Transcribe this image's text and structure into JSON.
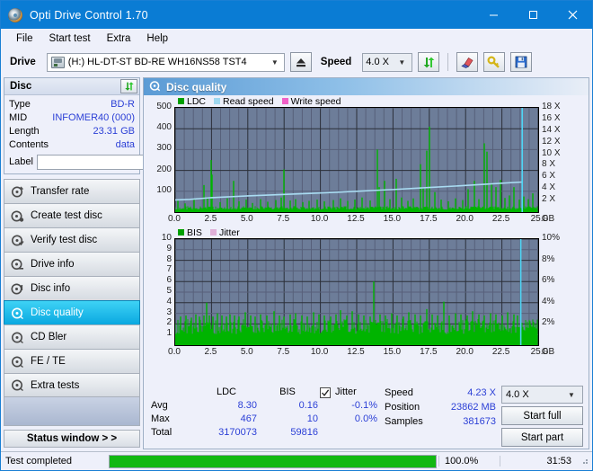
{
  "window": {
    "title": "Opti Drive Control 1.70",
    "icon": "disc-icon",
    "minimize_label": "–",
    "maximize_label": "☐",
    "close_label": "✕"
  },
  "menu": {
    "items": [
      "File",
      "Start test",
      "Extra",
      "Help"
    ]
  },
  "toolbar": {
    "drive_label": "Drive",
    "drive_value": "(H:)  HL-DT-ST BD-RE  WH16NS58 TST4",
    "eject_icon": "eject-icon",
    "speed_label": "Speed",
    "speed_value": "4.0 X",
    "refresh_icon": "refresh-icon",
    "eraser_icon": "eraser-icon",
    "tools_icon": "key-icon",
    "save_icon": "save-icon"
  },
  "disc_panel": {
    "title": "Disc",
    "refresh_icon": "refresh-icon",
    "rows": [
      {
        "key": "Type",
        "value": "BD-R"
      },
      {
        "key": "MID",
        "value": "INFOMER40 (000)"
      },
      {
        "key": "Length",
        "value": "23.31 GB"
      },
      {
        "key": "Contents",
        "value": "data"
      }
    ],
    "label_key": "Label",
    "label_value": "",
    "label_placeholder": "",
    "disc_icon": "disc-icon"
  },
  "sidebar": {
    "items": [
      {
        "label": "Transfer rate",
        "icon": "disc-rate-icon",
        "active": false
      },
      {
        "label": "Create test disc",
        "icon": "disc-write-icon",
        "active": false
      },
      {
        "label": "Verify test disc",
        "icon": "disc-verify-icon",
        "active": false
      },
      {
        "label": "Drive info",
        "icon": "drive-info-icon",
        "active": false
      },
      {
        "label": "Disc info",
        "icon": "disc-info-icon",
        "active": false
      },
      {
        "label": "Disc quality",
        "icon": "disc-quality-icon",
        "active": true
      },
      {
        "label": "CD Bler",
        "icon": "disc-bler-icon",
        "active": false
      },
      {
        "label": "FE / TE",
        "icon": "disc-fete-icon",
        "active": false
      },
      {
        "label": "Extra tests",
        "icon": "disc-extra-icon",
        "active": false
      }
    ],
    "status_window_label": "Status window > >"
  },
  "main": {
    "title": "Disc quality",
    "icon": "disc-quality-icon"
  },
  "chart_data": [
    {
      "id": "ldc-chart",
      "type": "bar",
      "title": "Disc quality",
      "xlabel": "",
      "ylabel": "",
      "xunit": "GB",
      "grid": true,
      "legend_position": "top-left",
      "legend": [
        {
          "label": "LDC",
          "color": "#00a000"
        },
        {
          "label": "Read speed",
          "color": "#9fd8f0"
        },
        {
          "label": "Write speed",
          "color": "#f060c8"
        }
      ],
      "xlim": [
        0,
        25
      ],
      "xticks": [
        "0.0",
        "2.5",
        "5.0",
        "7.5",
        "10.0",
        "12.5",
        "15.0",
        "17.5",
        "20.0",
        "22.5",
        "25.0"
      ],
      "ylim": [
        0,
        500
      ],
      "yticks": [
        "100",
        "200",
        "300",
        "400",
        "500"
      ],
      "y2lim": [
        0,
        18
      ],
      "y2ticks": [
        "2 X",
        "4 X",
        "6 X",
        "8 X",
        "10 X",
        "12 X",
        "14 X",
        "16 X",
        "18 X"
      ],
      "series": [
        {
          "name": "LDC",
          "color": "#00b400",
          "baseline": 22,
          "spikes": [
            [
              0.2,
              55
            ],
            [
              0.7,
              42
            ],
            [
              1.3,
              60
            ],
            [
              2.0,
              130
            ],
            [
              2.25,
              72
            ],
            [
              2.5,
              250
            ],
            [
              2.55,
              180
            ],
            [
              3.1,
              48
            ],
            [
              3.6,
              66
            ],
            [
              4.0,
              150
            ],
            [
              4.4,
              52
            ],
            [
              4.9,
              60
            ],
            [
              5.3,
              44
            ],
            [
              5.9,
              62
            ],
            [
              6.4,
              50
            ],
            [
              6.9,
              58
            ],
            [
              7.3,
              70
            ],
            [
              7.5,
              205
            ],
            [
              7.9,
              56
            ],
            [
              8.3,
              62
            ],
            [
              8.8,
              48
            ],
            [
              9.2,
              54
            ],
            [
              9.8,
              60
            ],
            [
              10.3,
              52
            ],
            [
              10.9,
              58
            ],
            [
              11.4,
              66
            ],
            [
              11.9,
              54
            ],
            [
              12.4,
              60
            ],
            [
              12.9,
              70
            ],
            [
              13.4,
              56
            ],
            [
              13.9,
              300
            ],
            [
              14.05,
              120
            ],
            [
              14.4,
              150
            ],
            [
              14.8,
              62
            ],
            [
              15.2,
              160
            ],
            [
              15.6,
              70
            ],
            [
              16.0,
              54
            ],
            [
              16.4,
              66
            ],
            [
              16.9,
              230
            ],
            [
              17.1,
              120
            ],
            [
              17.35,
              295
            ],
            [
              17.5,
              410
            ],
            [
              17.9,
              96
            ],
            [
              18.3,
              60
            ],
            [
              18.8,
              52
            ],
            [
              19.3,
              66
            ],
            [
              19.8,
              58
            ],
            [
              20.2,
              110
            ],
            [
              20.6,
              150
            ],
            [
              20.9,
              62
            ],
            [
              21.3,
              330
            ],
            [
              21.5,
              290
            ],
            [
              21.8,
              140
            ],
            [
              22.1,
              120
            ],
            [
              22.4,
              155
            ],
            [
              22.7,
              68
            ],
            [
              23.0,
              80
            ],
            [
              23.3,
              120
            ],
            [
              23.7,
              60
            ],
            [
              24.0,
              75
            ],
            [
              24.3,
              62
            ],
            [
              24.6,
              90
            ]
          ]
        },
        {
          "name": "Read speed",
          "color": "#a9dcf2",
          "points": [
            [
              0.0,
              2.1
            ],
            [
              1.0,
              2.2
            ],
            [
              2.5,
              2.5
            ],
            [
              5.0,
              2.8
            ],
            [
              7.5,
              3.05
            ],
            [
              10.0,
              3.3
            ],
            [
              12.5,
              3.6
            ],
            [
              15.0,
              3.9
            ],
            [
              17.5,
              4.25
            ],
            [
              20.0,
              4.6
            ],
            [
              22.5,
              5.0
            ],
            [
              23.9,
              5.2
            ]
          ]
        },
        {
          "name": "Write speed",
          "color": "#f060c8",
          "points": []
        }
      ],
      "end_marker": {
        "x": 23.9,
        "color": "#4fd5f5"
      }
    },
    {
      "id": "bis-chart",
      "type": "bar",
      "title": "",
      "xunit": "GB",
      "grid": true,
      "legend_position": "top-left",
      "legend": [
        {
          "label": "BIS",
          "color": "#00a000"
        },
        {
          "label": "Jitter",
          "color": "#e0b0d8"
        }
      ],
      "xlim": [
        0,
        25
      ],
      "xticks": [
        "0.0",
        "2.5",
        "5.0",
        "7.5",
        "10.0",
        "12.5",
        "15.0",
        "17.5",
        "20.0",
        "22.5",
        "25.0"
      ],
      "ylim": [
        0,
        10
      ],
      "yticks": [
        "1",
        "2",
        "3",
        "4",
        "5",
        "6",
        "7",
        "8",
        "9",
        "10"
      ],
      "y2lim": [
        0,
        10
      ],
      "y2ticks": [
        "2%",
        "4%",
        "6%",
        "8%",
        "10%"
      ],
      "series": [
        {
          "name": "BIS",
          "color": "#00b400",
          "baseline": 1.9,
          "spikes": [
            [
              0.35,
              2.7
            ],
            [
              0.75,
              2.8
            ],
            [
              1.1,
              2.6
            ],
            [
              1.45,
              2.9
            ],
            [
              1.7,
              2.7
            ],
            [
              1.95,
              2.8
            ],
            [
              2.15,
              4.0
            ],
            [
              2.35,
              2.8
            ],
            [
              2.6,
              2.7
            ],
            [
              2.9,
              3.0
            ],
            [
              3.2,
              2.8
            ],
            [
              3.5,
              2.7
            ],
            [
              3.8,
              2.9
            ],
            [
              4.1,
              2.8
            ],
            [
              4.4,
              2.7
            ],
            [
              4.8,
              3.1
            ],
            [
              5.2,
              2.8
            ],
            [
              5.5,
              2.7
            ],
            [
              5.9,
              2.9
            ],
            [
              6.3,
              2.8
            ],
            [
              6.8,
              3.2
            ],
            [
              7.2,
              2.8
            ],
            [
              7.5,
              2.7
            ],
            [
              7.9,
              2.9
            ],
            [
              8.3,
              3.0
            ],
            [
              8.7,
              2.8
            ],
            [
              9.1,
              2.7
            ],
            [
              9.5,
              3.1
            ],
            [
              9.9,
              2.9
            ],
            [
              10.3,
              2.8
            ],
            [
              10.7,
              2.7
            ],
            [
              11.1,
              2.9
            ],
            [
              11.4,
              3.3
            ],
            [
              11.8,
              2.8
            ],
            [
              12.2,
              3.2
            ],
            [
              12.6,
              2.9
            ],
            [
              13.0,
              2.8
            ],
            [
              13.4,
              2.7
            ],
            [
              13.7,
              6.0
            ],
            [
              14.1,
              2.9
            ],
            [
              14.5,
              2.8
            ],
            [
              14.9,
              3.0
            ],
            [
              15.3,
              2.8
            ],
            [
              15.7,
              2.7
            ],
            [
              16.1,
              3.1
            ],
            [
              16.5,
              2.9
            ],
            [
              16.9,
              2.8
            ],
            [
              17.3,
              3.4
            ],
            [
              17.7,
              2.9
            ],
            [
              18.1,
              2.8
            ],
            [
              18.5,
              4.1
            ],
            [
              18.9,
              2.8
            ],
            [
              19.3,
              3.0
            ],
            [
              19.7,
              2.9
            ],
            [
              20.1,
              2.8
            ],
            [
              20.5,
              3.2
            ],
            [
              20.9,
              2.9
            ],
            [
              21.3,
              2.8
            ],
            [
              21.7,
              3.0
            ],
            [
              22.1,
              2.9
            ],
            [
              22.5,
              2.8
            ],
            [
              22.9,
              3.1
            ],
            [
              23.3,
              2.9
            ],
            [
              23.6,
              2.8
            ]
          ]
        },
        {
          "name": "Jitter",
          "color": "#e0b0d8",
          "points": []
        }
      ],
      "end_marker": {
        "x": 23.8,
        "color": "#4fd5f5"
      }
    }
  ],
  "stats": {
    "columns": [
      "LDC",
      "BIS"
    ],
    "rows": [
      {
        "label": "Avg",
        "ldc": "8.30",
        "bis": "0.16",
        "jitter": "-0.1%"
      },
      {
        "label": "Max",
        "ldc": "467",
        "bis": "10",
        "jitter": "0.0%"
      },
      {
        "label": "Total",
        "ldc": "3170073",
        "bis": "59816",
        "jitter": ""
      }
    ],
    "jitter_label": "Jitter",
    "jitter_checked": true,
    "jitter_checkmark": "✔"
  },
  "readout": {
    "speed_label": "Speed",
    "speed_value": "4.23 X",
    "position_label": "Position",
    "position_value": "23862 MB",
    "samples_label": "Samples",
    "samples_value": "381673"
  },
  "actions": {
    "speed_select": "4.0 X",
    "start_full_label": "Start full",
    "start_part_label": "Start part"
  },
  "statusbar": {
    "message": "Test completed",
    "progress_percent": 100,
    "progress_text": "100.0%",
    "elapsed": "31:53"
  },
  "colors": {
    "accent": "#0a7cd4",
    "value_text": "#2b3fd6",
    "plot_bg": "#6d7d99",
    "ldc_green": "#00b400",
    "read_speed": "#a9dcf2",
    "write_speed": "#f060c8",
    "jitter": "#e0b0d8",
    "progress": "#12b812"
  }
}
